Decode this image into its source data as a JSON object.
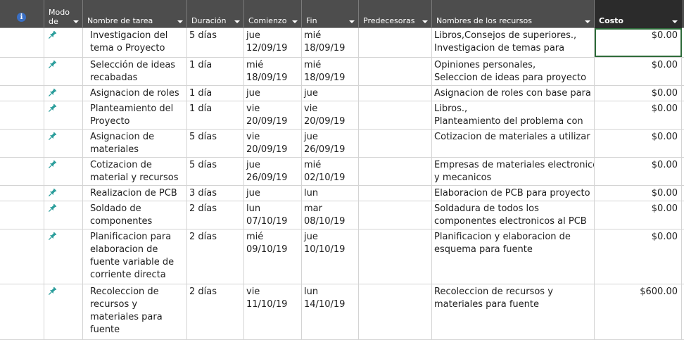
{
  "header": {
    "info_glyph": "i",
    "columns": {
      "mode": "Modo\nde",
      "name": "Nombre de tarea",
      "duration": "Duración",
      "start": "Comienzo",
      "finish": "Fin",
      "predecessors": "Predecesoras",
      "resources": "Nombres de los recursos",
      "cost": "Costo"
    }
  },
  "colors": {
    "header_bg": "#4d4d4d",
    "active_header_bg": "#2b2b2b",
    "pin": "#2a9d9b",
    "selection": "#2e6b3a",
    "info_icon": "#3a6fc4"
  },
  "task_mode_icon": "pushpin-icon",
  "rows": [
    {
      "name": "Investigacion del\ntema o Proyecto",
      "duration": "5 días",
      "start": "jue\n12/09/19",
      "finish": "mié\n18/09/19",
      "predecessors": "",
      "resources": "Libros,Consejos de superiores.,\nInvestigacion de temas para",
      "cost": "$0.00"
    },
    {
      "name": "Selección de ideas\nrecabadas",
      "duration": "1 día",
      "start": "mié\n18/09/19",
      "finish": "mié\n18/09/19",
      "predecessors": "",
      "resources": "Opiniones personales,\nSeleccion de ideas para proyecto",
      "cost": "$0.00"
    },
    {
      "name": "Asignacion de roles",
      "duration": "1 día",
      "start": "jue 19/09/19",
      "finish": "jue 19/09/19",
      "predecessors": "",
      "resources": "Asignacion de roles con base para la e",
      "cost": "$0.00"
    },
    {
      "name": "Planteamiento del\nProyecto",
      "duration": "1 día",
      "start": "vie 20/09/19",
      "finish": "vie 20/09/19",
      "predecessors": "",
      "resources": "Libros.,\nPlanteamiento del problema con",
      "cost": "$0.00"
    },
    {
      "name": "Asignacion de\nmateriales",
      "duration": "5 días",
      "start": "vie 20/09/19",
      "finish": "jue\n26/09/19",
      "predecessors": "",
      "resources": "Cotizacion de materiales a utilizar",
      "cost": "$0.00"
    },
    {
      "name": "Cotizacion de\nmaterial y recursos",
      "duration": "5 días",
      "start": "jue\n26/09/19",
      "finish": "mié\n02/10/19",
      "predecessors": "",
      "resources": "Empresas de materiales electronicos\ny mecanicos",
      "cost": "$0.00"
    },
    {
      "name": "Realizacion  de PCB",
      "duration": "3 días",
      "start": "jue 03/10/19",
      "finish": "lun 07/10/19",
      "predecessors": "",
      "resources": "Elaboracion de PCB para proyecto",
      "cost": "$0.00"
    },
    {
      "name": "Soldado de\ncomponentes",
      "duration": "2 días",
      "start": "lun\n07/10/19",
      "finish": "mar\n08/10/19",
      "predecessors": "",
      "resources": "Soldadura de todos los\ncomponentes electronicos al PCB",
      "cost": "$0.00"
    },
    {
      "name": "Planificacion para\nelaboracion de\nfuente variable de\ncorriente directa",
      "duration": "2 días",
      "start": "mié\n09/10/19",
      "finish": "jue\n10/10/19",
      "predecessors": "",
      "resources": "Planificacion y elaboracion de\nesquema para fuente",
      "cost": "$0.00"
    },
    {
      "name": "Recoleccion de\nrecursos y\nmateriales para\nfuente",
      "duration": "2 días",
      "start": "vie 11/10/19",
      "finish": "lun\n14/10/19",
      "predecessors": "",
      "resources": "Recoleccion de recursos y\nmateriales para fuente",
      "cost": "$600.00"
    }
  ]
}
